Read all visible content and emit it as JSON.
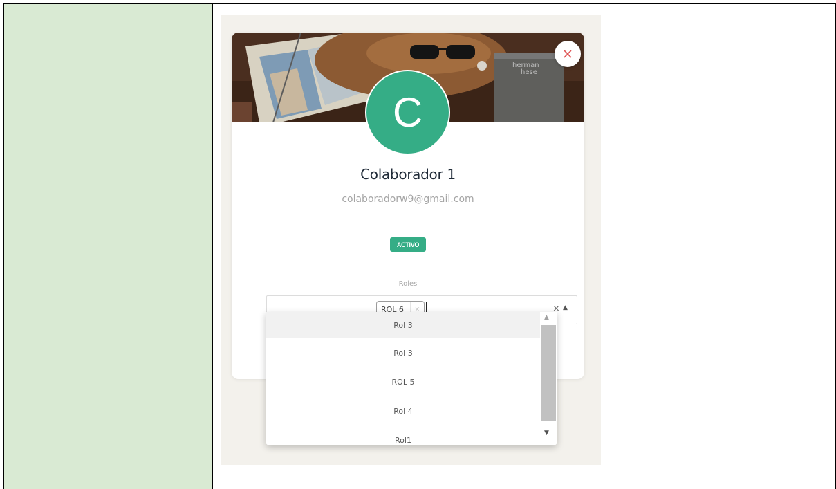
{
  "profile": {
    "avatar_initial": "C",
    "name": "Colaborador 1",
    "email": "colaboradorw9@gmail.com",
    "status": "ACTIVO"
  },
  "roles": {
    "label": "Roles",
    "selected": [
      {
        "label": "ROL 6",
        "remove_glyph": "×"
      }
    ],
    "clear_glyph": "×",
    "toggle_glyph": "▲",
    "options": [
      "Rol 3",
      "Rol 3",
      "ROL 5",
      "Rol 4",
      "Rol1"
    ]
  },
  "icons": {
    "close": "close-icon",
    "scroll_up": "▲",
    "scroll_down": "▼"
  },
  "colors": {
    "accent": "#35ad86",
    "left_panel": "#d9ead3",
    "close_x": "#e05757"
  }
}
